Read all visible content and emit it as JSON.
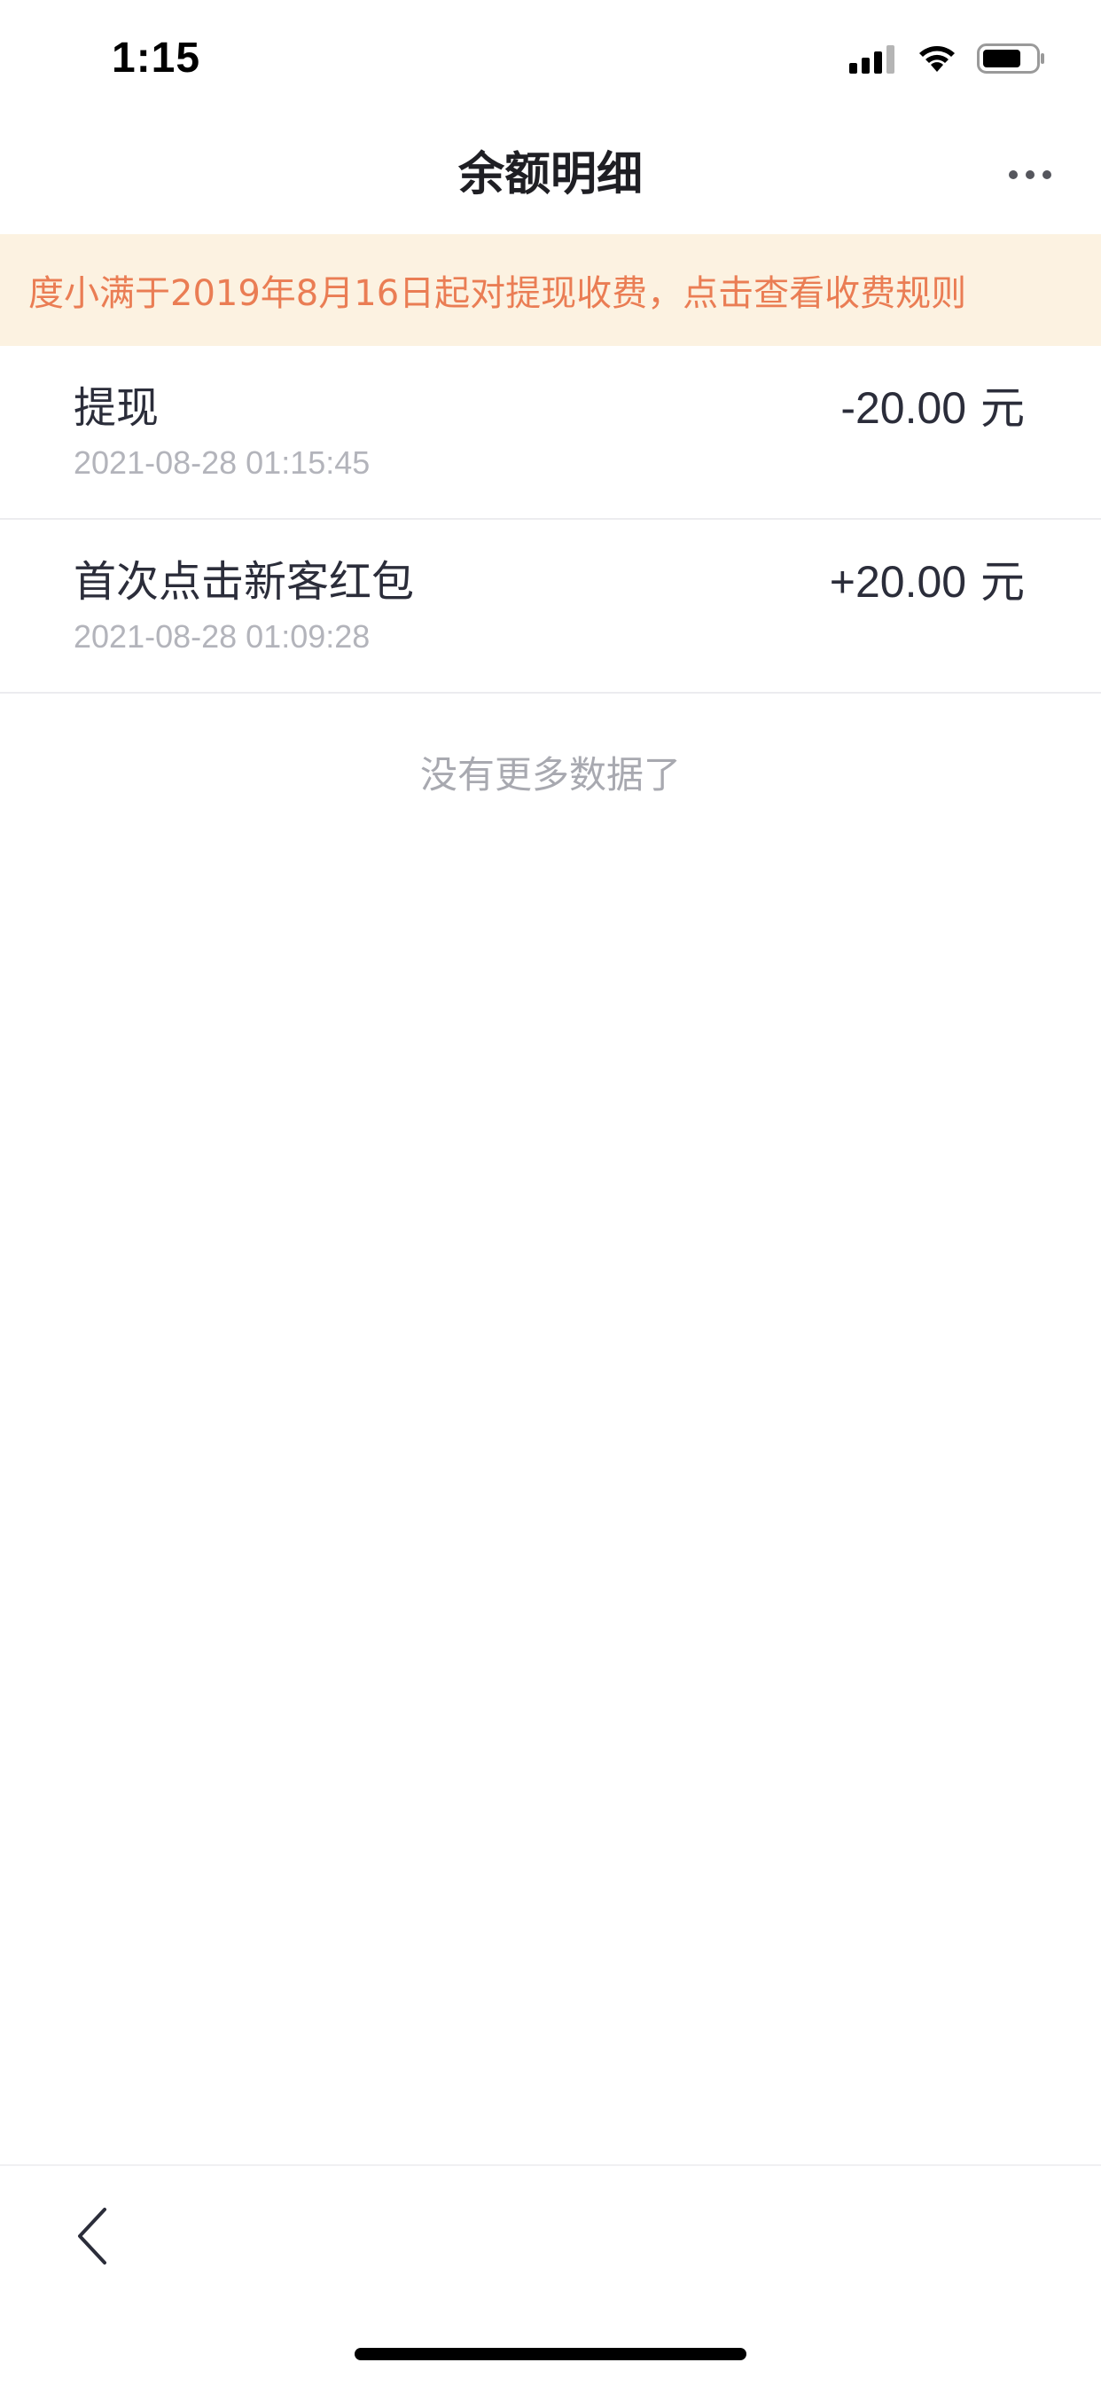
{
  "status_bar": {
    "time": "1:15",
    "icons": [
      "cellular-signal-icon",
      "wifi-icon",
      "battery-icon"
    ]
  },
  "nav": {
    "title": "余额明细",
    "more_icon": "more-dots-icon"
  },
  "notice": {
    "text": "度小满于2019年8月16日起对提现收费，点击查看收费规则",
    "text_color": "#ea7d54",
    "background": "#fcf2e1"
  },
  "records": [
    {
      "title": "提现",
      "time": "2021-08-28 01:15:45",
      "amount": "-20.00",
      "unit": "元"
    },
    {
      "title": "首次点击新客红包",
      "time": "2021-08-28 01:09:28",
      "amount": "+20.00",
      "unit": "元"
    }
  ],
  "footer_message": "没有更多数据了",
  "bottom_bar": {
    "back_icon": "back-chevron-icon"
  }
}
